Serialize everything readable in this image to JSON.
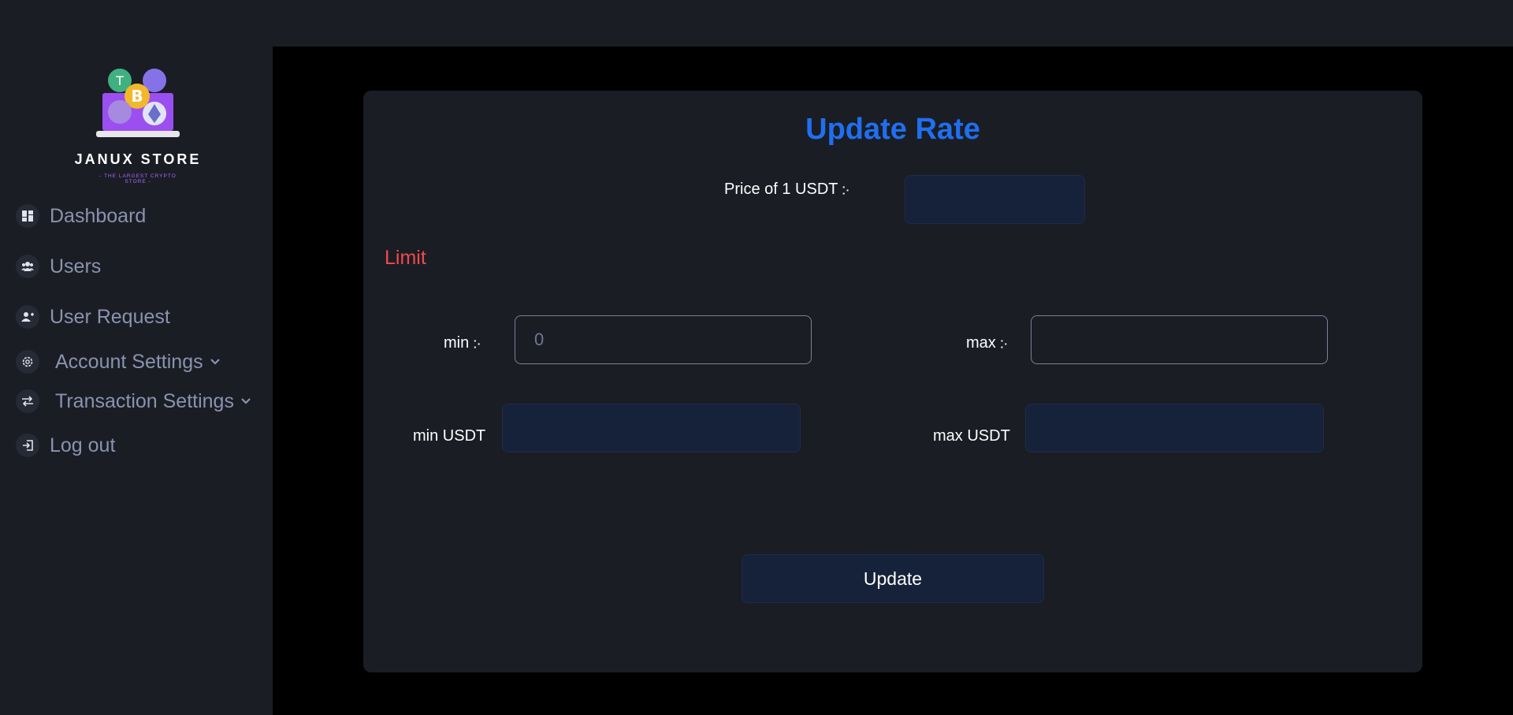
{
  "brand": {
    "name": "JANUX STORE",
    "tagline": "- THE LARGEST CRYPTO STORE -"
  },
  "sidebar": {
    "items": [
      {
        "label": "Dashboard",
        "icon": "dashboard-icon"
      },
      {
        "label": "Users",
        "icon": "users-icon"
      },
      {
        "label": "User Request",
        "icon": "user-plus-icon"
      },
      {
        "label": "Account Settings",
        "icon": "gear-icon",
        "has_dropdown": true
      },
      {
        "label": "Transaction Settings",
        "icon": "swap-arrows-icon",
        "has_dropdown": true
      },
      {
        "label": "Log out",
        "icon": "logout-icon"
      }
    ]
  },
  "form": {
    "title": "Update Rate",
    "price_label": "Price of 1 USDT ჻",
    "price_value": "",
    "limit_heading": "Limit",
    "min_local_label": "min ჻",
    "min_local_placeholder": "0",
    "max_local_label": "max ჻",
    "max_local_value": "",
    "min_usdt_label": "min USDT",
    "min_usdt_value": "",
    "max_usdt_label": "max USDT",
    "max_usdt_value": "",
    "submit_label": "Update"
  },
  "colors": {
    "accent": "#1f6ff0",
    "limit": "#f04b4b",
    "background": "#1b1d25",
    "main_bg": "#000000",
    "field_bg": "#16223a"
  }
}
